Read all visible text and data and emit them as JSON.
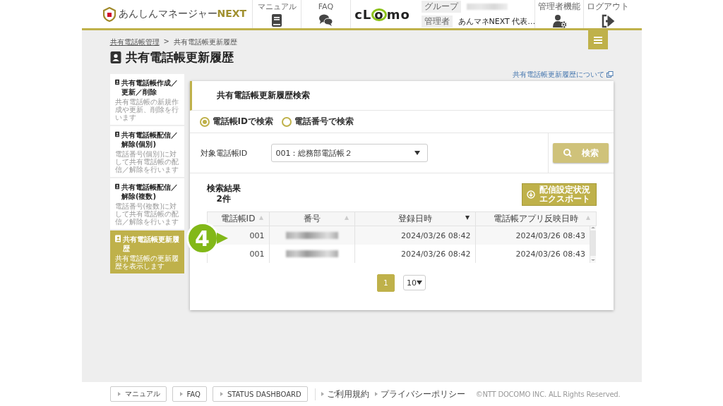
{
  "header": {
    "logo_text": "あんしんマネージャー",
    "logo_accent": "NEXT",
    "nav": [
      {
        "label": "マニュアル"
      },
      {
        "label": "FAQ"
      }
    ],
    "brand": "cLomo",
    "info": [
      {
        "label": "グループ",
        "kind": "redacted"
      },
      {
        "label": "管理者",
        "kind": "text",
        "value": "あんマネNEXT 代表…"
      }
    ],
    "tools": [
      {
        "label": "管理者機能"
      },
      {
        "label": "ログアウト"
      }
    ]
  },
  "breadcrumb": {
    "items": [
      {
        "label": "共有電話帳管理"
      },
      {
        "label": "共有電話帳更新履歴"
      }
    ],
    "separator": ">"
  },
  "page_title": "共有電話帳更新履歴",
  "help_link": "共有電話帳更新履歴について",
  "sidebar": {
    "items": [
      {
        "title": "共有電話帳作成／更新／削除",
        "description": "共有電話帳の新規作成や更新、削除を行います",
        "selected": false
      },
      {
        "title": "共有電話帳配信／解除(個別)",
        "description": "電話番号(個別)に対して共有電話帳の配信／解除を行います",
        "selected": false
      },
      {
        "title": "共有電話帳配信／解除(複数)",
        "description": "電話番号(複数)に対して共有電話帳の配信／解除を行います",
        "selected": false
      },
      {
        "title": "共有電話帳更新履歴",
        "description": "共有電話帳の更新履歴を表示します",
        "selected": true
      }
    ]
  },
  "panel": {
    "title": "共有電話帳更新履歴検索",
    "radios": [
      {
        "label": "電話帳IDで検索",
        "selected": true
      },
      {
        "label": "電話番号で検索",
        "selected": false
      }
    ],
    "field_label": "対象電話帳ID",
    "select_value": "001：総務部電話帳２",
    "search_button": "検索",
    "results_title": "検索結果",
    "results_count": "2件",
    "export_button": [
      "配信設定状況",
      "エクスポート"
    ],
    "table": {
      "columns": [
        {
          "label": "電話帳ID",
          "sorted": false
        },
        {
          "label": "番号",
          "sorted": false
        },
        {
          "label": "登録日時",
          "sorted": true
        },
        {
          "label": "電話帳アプリ反映日時",
          "sorted": false
        }
      ],
      "rows": [
        {
          "id": "001",
          "registered": "2024/03/26 08:42",
          "applied": "2024/03/26 08:43"
        },
        {
          "id": "001",
          "registered": "2024/03/26 08:42",
          "applied": "2024/03/26 08:43"
        }
      ]
    },
    "pages": [
      {
        "label": "1",
        "selected": true
      }
    ],
    "per_page": "10"
  },
  "callout": {
    "label": "4"
  },
  "footer": {
    "buttons": [
      "マニュアル",
      "FAQ",
      "STATUS DASHBOARD"
    ],
    "links": [
      "ご利用規約",
      "プライバシーポリシー"
    ],
    "copyright": "©NTT DOCOMO INC. ALL Rights Reserved."
  }
}
